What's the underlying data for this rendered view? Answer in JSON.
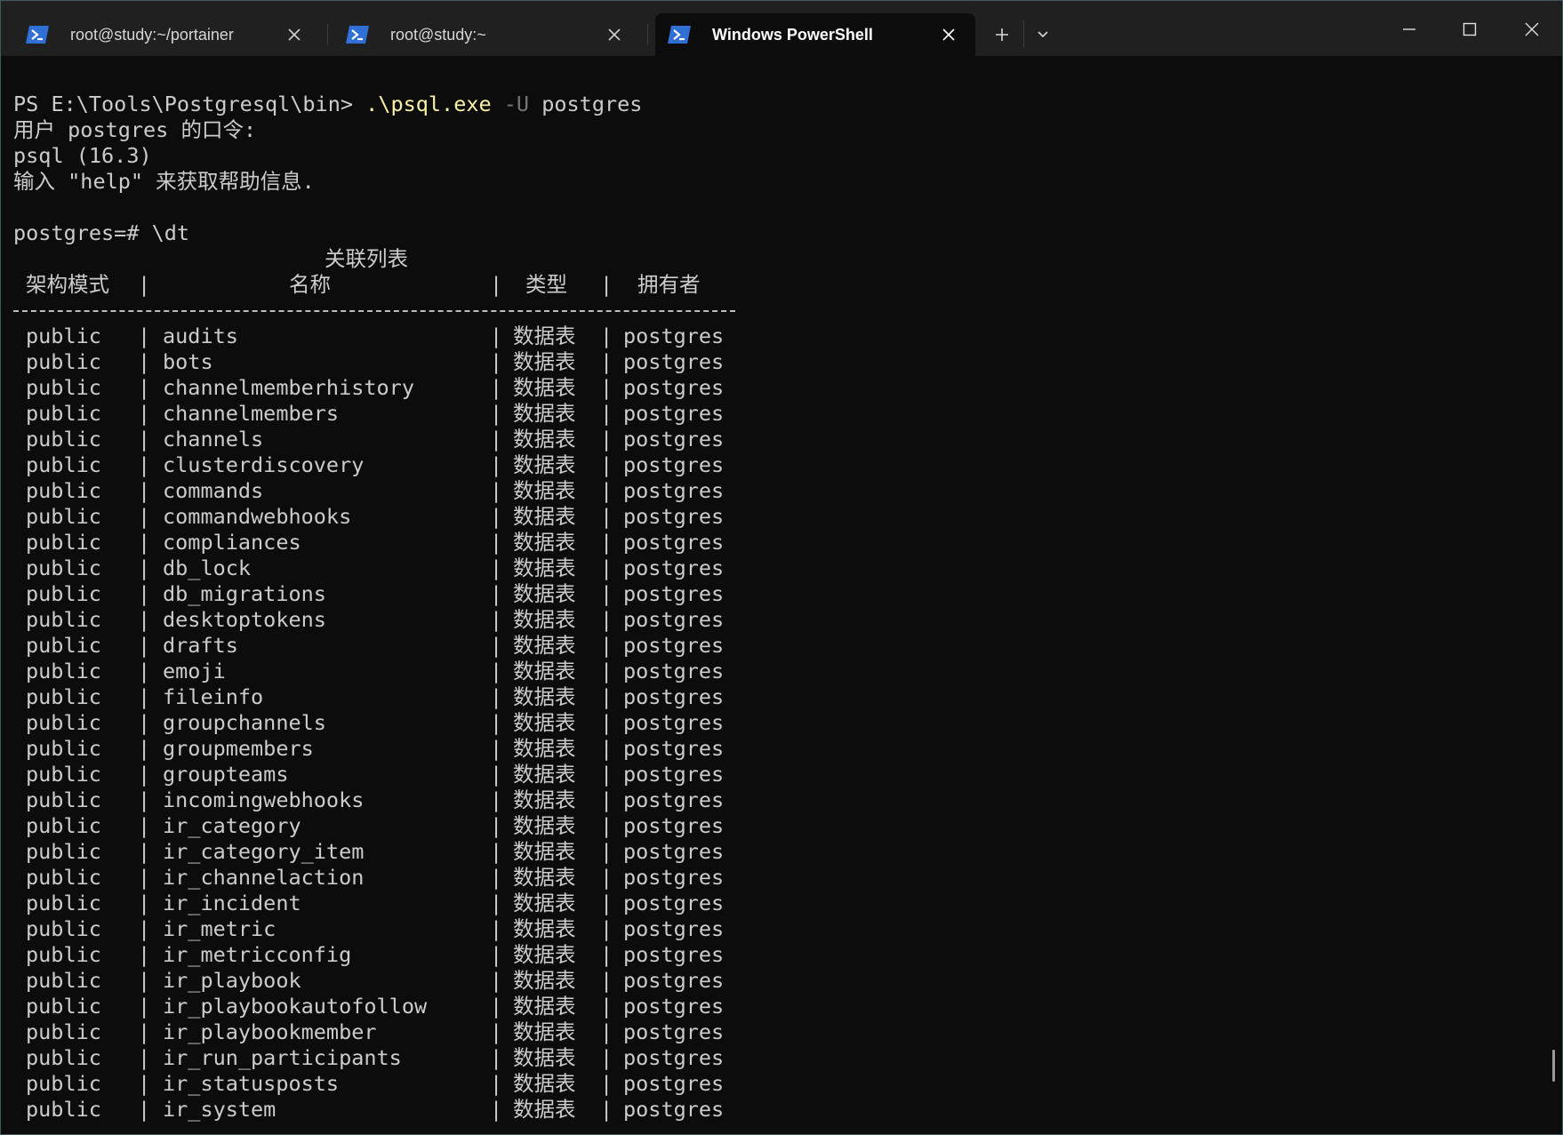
{
  "tabs": [
    {
      "label": "root@study:~/portainer",
      "icon": "powershell-icon"
    },
    {
      "label": "root@study:~",
      "icon": "powershell-icon"
    },
    {
      "label": "Windows PowerShell",
      "icon": "powershell-icon",
      "active": true
    }
  ],
  "window_controls": {
    "new_tab": "+",
    "minimize": "minimize-icon",
    "maximize": "maximize-icon",
    "close": "close-icon"
  },
  "terminal": {
    "prompt": "PS E:\\Tools\\Postgresql\\bin> ",
    "command_exe": ".\\psql.exe",
    "command_flag": " -U",
    "command_arg": " postgres",
    "password_prompt": "用户 postgres 的口令:",
    "version": "psql (16.3)",
    "help_hint": "输入 \"help\" 来获取帮助信息.",
    "psql_prompt": "postgres=# \\dt",
    "table_title": "关联列表",
    "columns": {
      "schema": "架构模式",
      "name": "名称",
      "type": "类型",
      "owner": "拥有者"
    },
    "separator": "|",
    "rows": [
      {
        "schema": "public",
        "name": "audits",
        "type": "数据表",
        "owner": "postgres"
      },
      {
        "schema": "public",
        "name": "bots",
        "type": "数据表",
        "owner": "postgres"
      },
      {
        "schema": "public",
        "name": "channelmemberhistory",
        "type": "数据表",
        "owner": "postgres"
      },
      {
        "schema": "public",
        "name": "channelmembers",
        "type": "数据表",
        "owner": "postgres"
      },
      {
        "schema": "public",
        "name": "channels",
        "type": "数据表",
        "owner": "postgres"
      },
      {
        "schema": "public",
        "name": "clusterdiscovery",
        "type": "数据表",
        "owner": "postgres"
      },
      {
        "schema": "public",
        "name": "commands",
        "type": "数据表",
        "owner": "postgres"
      },
      {
        "schema": "public",
        "name": "commandwebhooks",
        "type": "数据表",
        "owner": "postgres"
      },
      {
        "schema": "public",
        "name": "compliances",
        "type": "数据表",
        "owner": "postgres"
      },
      {
        "schema": "public",
        "name": "db_lock",
        "type": "数据表",
        "owner": "postgres"
      },
      {
        "schema": "public",
        "name": "db_migrations",
        "type": "数据表",
        "owner": "postgres"
      },
      {
        "schema": "public",
        "name": "desktoptokens",
        "type": "数据表",
        "owner": "postgres"
      },
      {
        "schema": "public",
        "name": "drafts",
        "type": "数据表",
        "owner": "postgres"
      },
      {
        "schema": "public",
        "name": "emoji",
        "type": "数据表",
        "owner": "postgres"
      },
      {
        "schema": "public",
        "name": "fileinfo",
        "type": "数据表",
        "owner": "postgres"
      },
      {
        "schema": "public",
        "name": "groupchannels",
        "type": "数据表",
        "owner": "postgres"
      },
      {
        "schema": "public",
        "name": "groupmembers",
        "type": "数据表",
        "owner": "postgres"
      },
      {
        "schema": "public",
        "name": "groupteams",
        "type": "数据表",
        "owner": "postgres"
      },
      {
        "schema": "public",
        "name": "incomingwebhooks",
        "type": "数据表",
        "owner": "postgres"
      },
      {
        "schema": "public",
        "name": "ir_category",
        "type": "数据表",
        "owner": "postgres"
      },
      {
        "schema": "public",
        "name": "ir_category_item",
        "type": "数据表",
        "owner": "postgres"
      },
      {
        "schema": "public",
        "name": "ir_channelaction",
        "type": "数据表",
        "owner": "postgres"
      },
      {
        "schema": "public",
        "name": "ir_incident",
        "type": "数据表",
        "owner": "postgres"
      },
      {
        "schema": "public",
        "name": "ir_metric",
        "type": "数据表",
        "owner": "postgres"
      },
      {
        "schema": "public",
        "name": "ir_metricconfig",
        "type": "数据表",
        "owner": "postgres"
      },
      {
        "schema": "public",
        "name": "ir_playbook",
        "type": "数据表",
        "owner": "postgres"
      },
      {
        "schema": "public",
        "name": "ir_playbookautofollow",
        "type": "数据表",
        "owner": "postgres"
      },
      {
        "schema": "public",
        "name": "ir_playbookmember",
        "type": "数据表",
        "owner": "postgres"
      },
      {
        "schema": "public",
        "name": "ir_run_participants",
        "type": "数据表",
        "owner": "postgres"
      },
      {
        "schema": "public",
        "name": "ir_statusposts",
        "type": "数据表",
        "owner": "postgres"
      },
      {
        "schema": "public",
        "name": "ir_system",
        "type": "数据表",
        "owner": "postgres"
      }
    ]
  },
  "colors": {
    "background": "#0c0c0c",
    "titlebar": "#202020",
    "text": "#cccccc",
    "exe_highlight": "#f9f1a5",
    "flag_dim": "#767676",
    "accent": "#3a78d8"
  }
}
